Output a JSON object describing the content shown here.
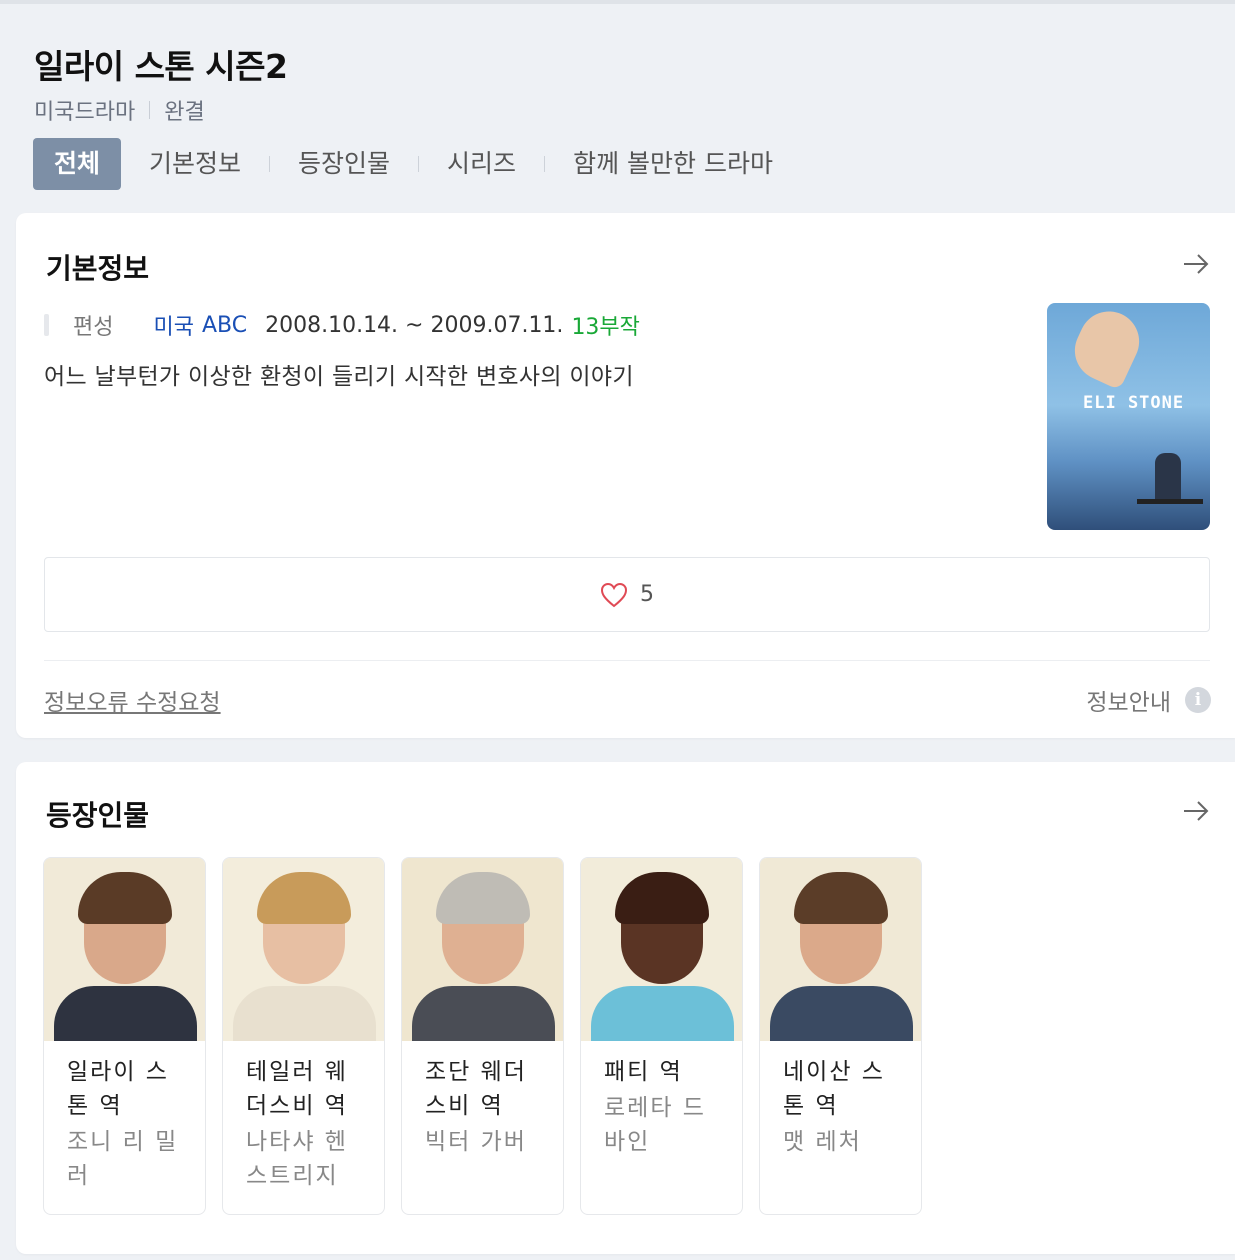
{
  "header": {
    "title": "일라이 스톤 시즌2",
    "genre": "미국드라마",
    "status": "완결"
  },
  "tabs": [
    {
      "label": "전체",
      "active": true
    },
    {
      "label": "기본정보",
      "active": false
    },
    {
      "label": "등장인물",
      "active": false
    },
    {
      "label": "시리즈",
      "active": false
    },
    {
      "label": "함께 볼만한 드라마",
      "active": false
    }
  ],
  "basic_info": {
    "section_title": "기본정보",
    "broadcast_label": "편성",
    "country": "미국",
    "network": "ABC",
    "period": "2008.10.14. ~ 2009.07.11.",
    "episodes": "13부작",
    "synopsis": "어느 날부턴가 이상한 환청이 들리기 시작한 변호사의 이야기",
    "poster_text": "ELI STONE",
    "like_count": "5",
    "report_link": "정보오류 수정요청",
    "info_guide": "정보안내",
    "info_icon": "i",
    "colors": {
      "like_heart": "#e04a55",
      "episodes": "#19a837",
      "link": "#1a4fb5"
    }
  },
  "cast": {
    "section_title": "등장인물",
    "members": [
      {
        "role": "일라이 스톤 역",
        "actor": "조니 리 밀러",
        "bg": "#f1ead8",
        "skin": "#d9a88a",
        "hair": "#5a3b26",
        "suit": "#2e3340"
      },
      {
        "role": "테일러 웨더스비 역",
        "actor": "나타샤 헨스트리지",
        "bg": "#f3eddc",
        "skin": "#e7bfa3",
        "hair": "#c89b5a",
        "suit": "#e8e0cf"
      },
      {
        "role": "조단 웨더스비 역",
        "actor": "빅터 가버",
        "bg": "#efe6cf",
        "skin": "#dfb092",
        "hair": "#bfbcb5",
        "suit": "#4a4d55"
      },
      {
        "role": "패티 역",
        "actor": "로레타 드바인",
        "bg": "#f2ecda",
        "skin": "#5a3424",
        "hair": "#3a1e14",
        "suit": "#6cc0d8"
      },
      {
        "role": "네이산 스톤 역",
        "actor": "맷 레처",
        "bg": "#f0e9d6",
        "skin": "#dba98a",
        "hair": "#5b3d28",
        "suit": "#3a4a62"
      }
    ]
  }
}
